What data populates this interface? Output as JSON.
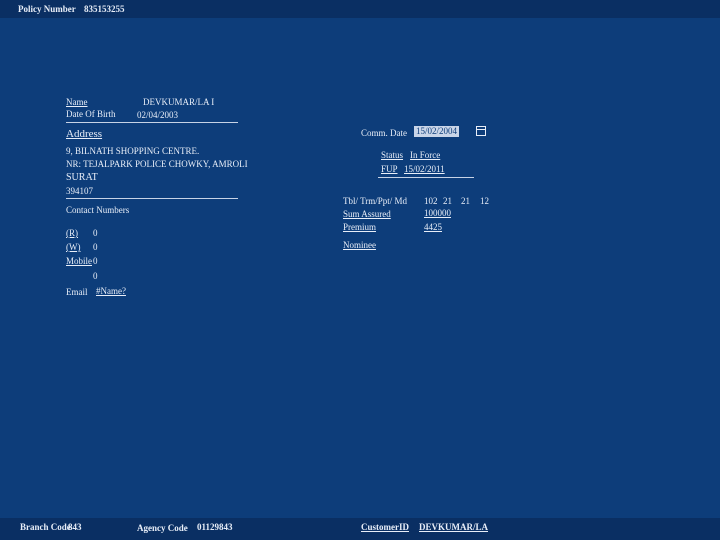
{
  "header": {
    "policy_number_label": "Policy Number",
    "policy_number": "835153255"
  },
  "customer": {
    "name_label": "Name",
    "name": "DEVKUMAR/LA I",
    "dob_label": "Date Of Birth",
    "dob": "02/04/2003",
    "address_label": "Address",
    "address_line1": "9, BILNATH SHOPPING CENTRE.",
    "address_line2": "NR: TEJALPARK POLICE CHOWKY, AMROLI",
    "address_line3": "SURAT",
    "address_line4": "394107"
  },
  "contact": {
    "label": "Contact Numbers",
    "res_label": "(R)",
    "res_value": "0",
    "work_label": "(W)",
    "work_value": "0",
    "mobile_label": "Mobile",
    "mobile_value": "0",
    "extra_value": "0",
    "email_label": "Email",
    "email_value": "#Name?"
  },
  "policy": {
    "comm_date_label": "Comm. Date",
    "comm_date": "15/02/2004",
    "status_label": "Status",
    "status_value": "In Force",
    "fup_label": "FUP",
    "fup_value": "15/02/2011",
    "tbl_label": "Tbl/ Trm/Ppt/ Md",
    "tbl": "102",
    "trm": "21",
    "ppt": "21",
    "md": "12",
    "sum_assured_label": "Sum Assured",
    "sum_assured": "100000",
    "premium_label": "Premium",
    "premium": "4425",
    "nominee_label": "Nominee"
  },
  "footer": {
    "branch_code_label": "Branch Code",
    "branch_code": "843",
    "agency_code_label": "Agency Code",
    "agency_code": "01129843",
    "customer_id_label": "CustomerID",
    "customer_id": "DEVKUMAR/LA"
  }
}
